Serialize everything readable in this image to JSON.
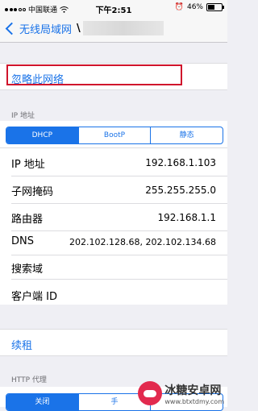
{
  "status_bar": {
    "carrier": "中国联通",
    "wifi": "wifi-icon",
    "time": "下午2:51",
    "battery_percent": "46%"
  },
  "nav": {
    "back_label": "无线局域网",
    "title_suffix": "\\"
  },
  "forget_label": "忽略此网络",
  "ip_section": {
    "header": "IP 地址",
    "tabs": [
      "DHCP",
      "BootP",
      "静态"
    ],
    "selected_tab": "DHCP",
    "rows": [
      {
        "label": "IP 地址",
        "value": "192.168.1.103"
      },
      {
        "label": "子网掩码",
        "value": "255.255.255.0"
      },
      {
        "label": "路由器",
        "value": "192.168.1.1"
      },
      {
        "label": "DNS",
        "value": "202.102.128.68, 202.102.134.68"
      },
      {
        "label": "搜索域",
        "value": ""
      },
      {
        "label": "客户端 ID",
        "value": ""
      }
    ]
  },
  "renew_label": "续租",
  "http_proxy": {
    "header": "HTTP 代理",
    "tabs": [
      "关闭",
      "手",
      ""
    ]
  },
  "watermark": {
    "name": "冰糖安卓网",
    "url": "www.btxtdmy.com"
  },
  "colors": {
    "accent": "#1a73e8",
    "highlight_border": "#d0142c"
  }
}
